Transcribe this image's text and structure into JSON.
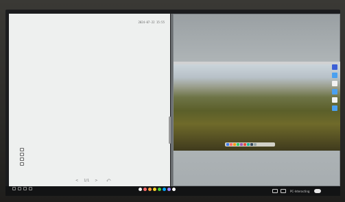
{
  "whiteboard": {
    "timestamp": "2024-07-22 15:55",
    "pager": {
      "prev": "<",
      "page": "1/1",
      "next": ">"
    },
    "undo_symbol": "⤺"
  },
  "taskbar": {
    "status_text": "PC-Interacting"
  },
  "colors": {
    "left_panel": "#eef0ef",
    "screen_bg": "#1b1c1e",
    "taskbar": "#121314",
    "color_dots": [
      "#f5f5f5",
      "#ff6b6b",
      "#ff9f43",
      "#ffd32a",
      "#4cd137",
      "#00a8ff",
      "#9c88ff",
      "#ffffff"
    ]
  }
}
